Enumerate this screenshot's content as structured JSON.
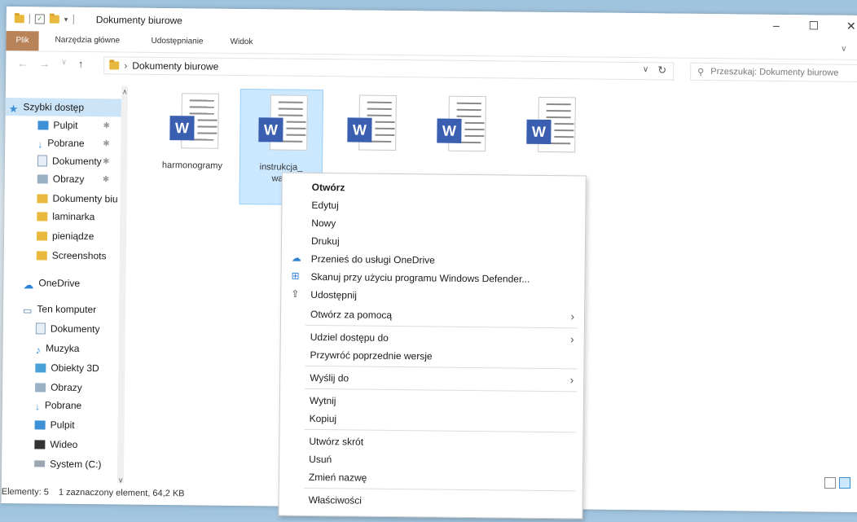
{
  "window": {
    "title": "Dokumenty biurowe",
    "controls": {
      "minimize": "–",
      "maximize": "☐",
      "close": "✕"
    }
  },
  "ribbon": {
    "tabs": [
      "Plik",
      "Narzędzia główne",
      "Udostępnianie",
      "Widok"
    ]
  },
  "address": {
    "path": "Dokumenty biurowe",
    "search_placeholder": "Przeszukaj: Dokumenty biurowe"
  },
  "sidebar": {
    "items": [
      {
        "label": "Szybki dostęp",
        "icon": "star-icon"
      },
      {
        "label": "Pulpit",
        "icon": "desktop-icon"
      },
      {
        "label": "Pobrane",
        "icon": "download-icon"
      },
      {
        "label": "Dokumenty",
        "icon": "documents-icon"
      },
      {
        "label": "Obrazy",
        "icon": "pictures-icon"
      },
      {
        "label": "Dokumenty biu",
        "icon": "folder-icon"
      },
      {
        "label": "laminarka",
        "icon": "folder-icon"
      },
      {
        "label": "pieniądze",
        "icon": "folder-icon"
      },
      {
        "label": "Screenshots",
        "icon": "folder-icon"
      },
      {
        "label": "OneDrive",
        "icon": "cloud-icon"
      },
      {
        "label": "Ten komputer",
        "icon": "computer-icon"
      },
      {
        "label": "Dokumenty",
        "icon": "documents-icon"
      },
      {
        "label": "Muzyka",
        "icon": "music-icon"
      },
      {
        "label": "Obiekty 3D",
        "icon": "cube-icon"
      },
      {
        "label": "Obrazy",
        "icon": "pictures-icon"
      },
      {
        "label": "Pobrane",
        "icon": "download-icon"
      },
      {
        "label": "Pulpit",
        "icon": "desktop-icon"
      },
      {
        "label": "Wideo",
        "icon": "video-icon"
      },
      {
        "label": "System (C:)",
        "icon": "drive-icon"
      }
    ]
  },
  "files": [
    {
      "name": "harmonogramy"
    },
    {
      "name": "instrukcja_\nwani"
    },
    {
      "name": ""
    },
    {
      "name": ""
    },
    {
      "name": ""
    }
  ],
  "context_menu": {
    "open": "Otwórz",
    "edit": "Edytuj",
    "new": "Nowy",
    "print": "Drukuj",
    "move_onedrive": "Przenieś do usługi OneDrive",
    "scan_defender": "Skanuj przy użyciu programu Windows Defender...",
    "share": "Udostępnij",
    "open_with": "Otwórz za pomocą",
    "give_access": "Udziel dostępu do",
    "restore_versions": "Przywróć poprzednie wersje",
    "send_to": "Wyślij do",
    "cut": "Wytnij",
    "copy": "Kopiuj",
    "create_shortcut": "Utwórz skrót",
    "delete": "Usuń",
    "rename": "Zmień nazwę",
    "properties": "Właściwości"
  },
  "status": {
    "count": "Elementy: 5",
    "selection": "1 zaznaczony element, 64,2 KB"
  },
  "colors": {
    "accent": "#3d8fd6",
    "word_blue": "#3a5fb0",
    "selection": "#cce8ff",
    "file_tab": "#b9835a"
  }
}
